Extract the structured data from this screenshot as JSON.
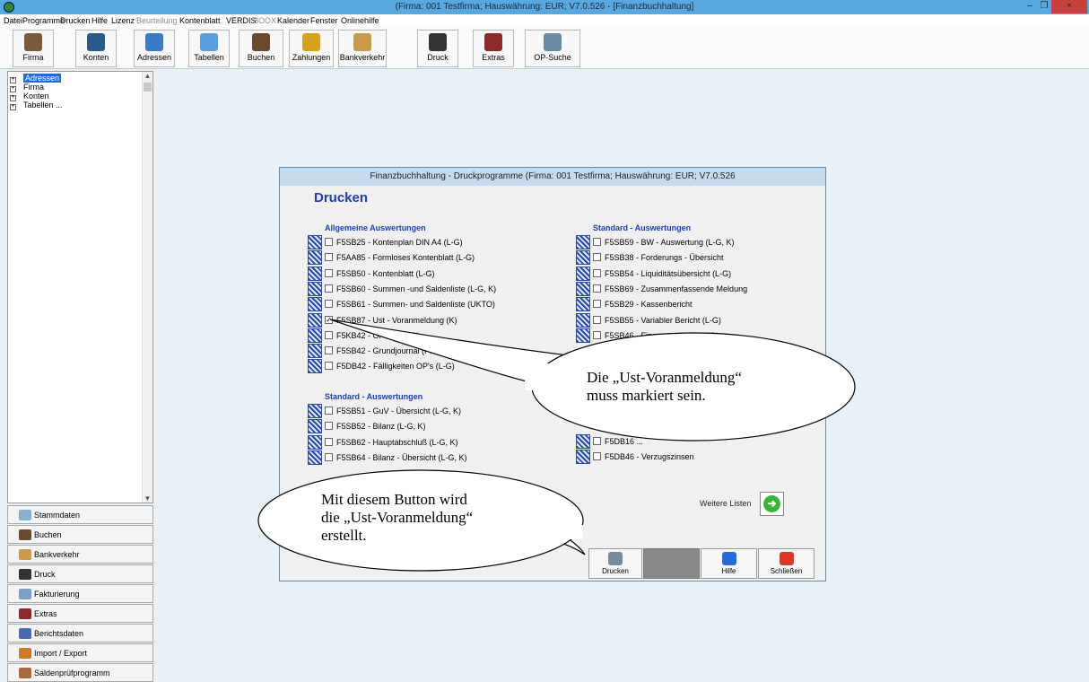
{
  "window": {
    "title": "(Firma: 001 Testfirma;  Hauswährung: EUR; V7.0.526 - [Finanzbuchhaltung]",
    "min_glyph": "–",
    "max_glyph": "❐",
    "close_glyph": "×"
  },
  "menu": [
    "Datei",
    "Programme",
    "Drucken",
    "Hilfe",
    "Lizenz",
    "Beurteilung",
    "Kontenblatt",
    "VERDIS",
    "BOOX",
    "Kalender",
    "Fenster",
    "Onlinehilfe"
  ],
  "toolbar": [
    {
      "label": "Firma",
      "icon": "books-icon",
      "color": "#7a5a3a"
    },
    {
      "label": "Konten",
      "icon": "folder-icon",
      "color": "#2a5a8a"
    },
    {
      "label": "Adressen",
      "icon": "address-card-icon",
      "color": "#3a7ac8"
    },
    {
      "label": "Tabellen",
      "icon": "table-icon",
      "color": "#5aa0e0"
    },
    {
      "label": "Buchen",
      "icon": "ledger-icon",
      "color": "#6a4a2a"
    },
    {
      "label": "Zahlungen",
      "icon": "coins-icon",
      "color": "#d8a020"
    },
    {
      "label": "Bankverkehr",
      "icon": "money-bag-icon",
      "color": "#c89a4a"
    },
    {
      "label": "Druck",
      "icon": "printer-icon",
      "color": "#333333"
    },
    {
      "label": "Extras",
      "icon": "tools-icon",
      "color": "#8a2a2a"
    },
    {
      "label": "OP-Suche",
      "icon": "search-docs-icon",
      "color": "#6a8aa8"
    }
  ],
  "tree": {
    "items": [
      "Adressen",
      "Firma",
      "Konten",
      "Tabellen ..."
    ],
    "expander": "+",
    "scroll_up": "▲",
    "scroll_down": "▼"
  },
  "nav": [
    {
      "label": "Stammdaten",
      "icon": "master-data-icon",
      "color": "#8ab0d0"
    },
    {
      "label": "Buchen",
      "icon": "ledger-icon",
      "color": "#6a4a2a"
    },
    {
      "label": "Bankverkehr",
      "icon": "money-bag-icon",
      "color": "#c89a4a"
    },
    {
      "label": "Druck",
      "icon": "printer-icon",
      "color": "#333333"
    },
    {
      "label": "Fakturierung",
      "icon": "invoice-icon",
      "color": "#7aa0c8"
    },
    {
      "label": "Extras",
      "icon": "tools-icon",
      "color": "#8a2a2a"
    },
    {
      "label": "Berichtsdaten",
      "icon": "report-icon",
      "color": "#4a6ab0"
    },
    {
      "label": "Import / Export",
      "icon": "import-export-icon",
      "color": "#c87a2a"
    },
    {
      "label": "Saldenprüfprogramm",
      "icon": "balance-check-icon",
      "color": "#a86a3a"
    }
  ],
  "dialog": {
    "title": "Finanzbuchhaltung - Druckprogramme   (Firma: 001 Testfirma;  Hauswährung: EUR; V7.0.526",
    "heading": "Drucken",
    "checkmark": "✓",
    "left_section1": {
      "title": "Allgemeine Auswertungen",
      "items": [
        {
          "label": "F5SB25 - Kontenplan DIN A4 (L-G)",
          "checked": false
        },
        {
          "label": "F5AA85 - Formloses Kontenblatt (L-G)",
          "checked": false
        },
        {
          "label": "F5SB50 - Kontenblatt (L-G)",
          "checked": false
        },
        {
          "label": "F5SB60 - Summen -und Saldenliste  (L-G, K)",
          "checked": false
        },
        {
          "label": "F5SB61 - Summen- und Saldenliste (UKTO)",
          "checked": false
        },
        {
          "label": "F5SB87 - Ust - Voranmeldung (K)",
          "checked": true
        },
        {
          "label": "F5KB42 - OP - ... (L-G)",
          "checked": false
        },
        {
          "label": "F5SB42 - Grundjournal (Primar...",
          "checked": false
        },
        {
          "label": "F5DB42 - Fälligkeiten OP's (L-G)",
          "checked": false
        }
      ]
    },
    "left_section2": {
      "title": "Standard - Auswertungen",
      "items": [
        {
          "label": "F5SB51 - GuV - Übersicht (L-G, K)",
          "checked": false
        },
        {
          "label": "F5SB52 - Bilanz (L-G, K)",
          "checked": false
        },
        {
          "label": "F5SB62 - Hauptabschluß (L-G, K)",
          "checked": false
        },
        {
          "label": "F5SB64 - Bilanz - Übersicht (L-G, K)",
          "checked": false
        }
      ]
    },
    "right_section1": {
      "title": "Standard - Auswertungen",
      "items": [
        {
          "label": "F5SB59 - BW - Auswertung (L-G, K)",
          "checked": false
        },
        {
          "label": "F5SB38 - Forderungs - Übersicht",
          "checked": false
        },
        {
          "label": "F5SB54 - Liquiditätsübersicht (L-G)",
          "checked": false
        },
        {
          "label": "F5SB69 - Zusammenfassende Meldung",
          "checked": false
        },
        {
          "label": "F5SB29 - Kassenbericht",
          "checked": false
        },
        {
          "label": "F5SB55 - Variabler Bericht (L-G)",
          "checked": false
        },
        {
          "label": "F5SB46 - Finanzvorschau (L-G)",
          "checked": false
        }
      ]
    },
    "right_section2": {
      "items": [
        {
          "label": "F5DB16 ...",
          "checked": false
        },
        {
          "label": "F5DB46 - Verzugszinsen",
          "checked": false
        }
      ]
    },
    "more_label": "Weitere Listen",
    "more_arrow": "➔",
    "buttons": [
      {
        "label": "Drucken",
        "icon": "printer-icon",
        "color": "#7a8a9a",
        "disabled": false
      },
      {
        "label": "",
        "icon": "blank-icon",
        "color": "#888888",
        "disabled": true
      },
      {
        "label": "Hilfe",
        "icon": "help-icon",
        "color": "#2a6ad8",
        "disabled": false
      },
      {
        "label": "Schließen",
        "icon": "close-x-icon",
        "color": "#d83a2a",
        "disabled": false
      }
    ]
  },
  "callouts": {
    "one": [
      "Die „Ust-Voranmeldung“",
      "muss markiert sein."
    ],
    "two": [
      "Mit diesem Button wird",
      "die „Ust-Voranmeldung“",
      "erstellt."
    ]
  }
}
